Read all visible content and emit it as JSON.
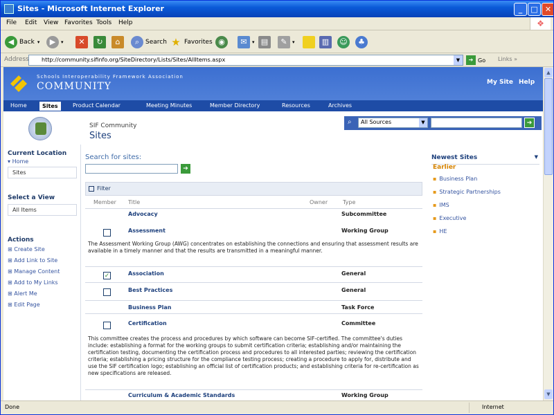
{
  "window": {
    "title": "Sites - Microsoft Internet Explorer"
  },
  "menu": [
    "File",
    "Edit",
    "View",
    "Favorites",
    "Tools",
    "Help"
  ],
  "toolbar": {
    "back": "Back",
    "search": "Search",
    "favorites": "Favorites"
  },
  "address": {
    "label": "Address",
    "url": "http://community.sifinfo.org/SiteDirectory/Lists/Sites/AllItems.aspx",
    "go": "Go",
    "links": "Links"
  },
  "header": {
    "org": "Schools Interoperability Framework Association",
    "community": "COMMUNITY",
    "my_site": "My Site",
    "help": "Help"
  },
  "nav": [
    "Home",
    "Sites",
    "Product Calendar",
    "Meeting Minutes",
    "Member Directory",
    "Resources",
    "Archives"
  ],
  "title_area": {
    "breadcrumb": "SIF Community",
    "title": "Sites"
  },
  "search": {
    "scope": "All Sources"
  },
  "leftnav": {
    "current_location": "Current Location",
    "home": "Home",
    "sites": "Sites",
    "select_view": "Select a View",
    "all_items": "All Items",
    "actions": "Actions",
    "action_items": [
      "Create Site",
      "Add Link to Site",
      "Manage Content",
      "Add to My Links",
      "Alert Me",
      "Edit Page"
    ]
  },
  "main": {
    "search_label": "Search for sites:",
    "filter": "Filter",
    "columns": [
      "Member",
      "Title",
      "Owner",
      "Type"
    ],
    "rows": [
      {
        "title": "Advocacy",
        "type": "Subcommittee"
      },
      {
        "title": "Assessment",
        "type": "Working Group"
      },
      {
        "title": "Association",
        "type": "General"
      },
      {
        "title": "Best Practices",
        "type": "General"
      },
      {
        "title": "Business Plan",
        "type": "Task Force"
      },
      {
        "title": "Certification",
        "type": "Committee"
      },
      {
        "title": "Curriculum & Academic Standards",
        "type": "Working Group"
      }
    ],
    "desc_assessment": "The Assessment Working Group (AWG) concentrates on establishing the connections and ensuring that assessment results are available in a timely manner and that the results are transmitted in a meaningful manner.",
    "desc_certification": "This committee creates the process and procedures by which software can become SIF-certified. The committee's duties include: establishing a format for the working groups to submit certification criteria; establishing and/or maintaining the certification testing, documenting the certification process and procedures to all interested parties; reviewing the certification criteria; establishing a pricing structure for the compliance testing process; creating a procedure to apply for, distribute and use the SIF certification logo; establishing an official list of certification products; and establishing criteria for re-certification as new specifications are released."
  },
  "right": {
    "heading": "Newest Sites",
    "earlier": "Earlier",
    "items": [
      "Business Plan",
      "Strategic Partnerships",
      "IMS",
      "Executive",
      "HE"
    ]
  },
  "status": {
    "done": "Done",
    "zone": "Internet"
  }
}
